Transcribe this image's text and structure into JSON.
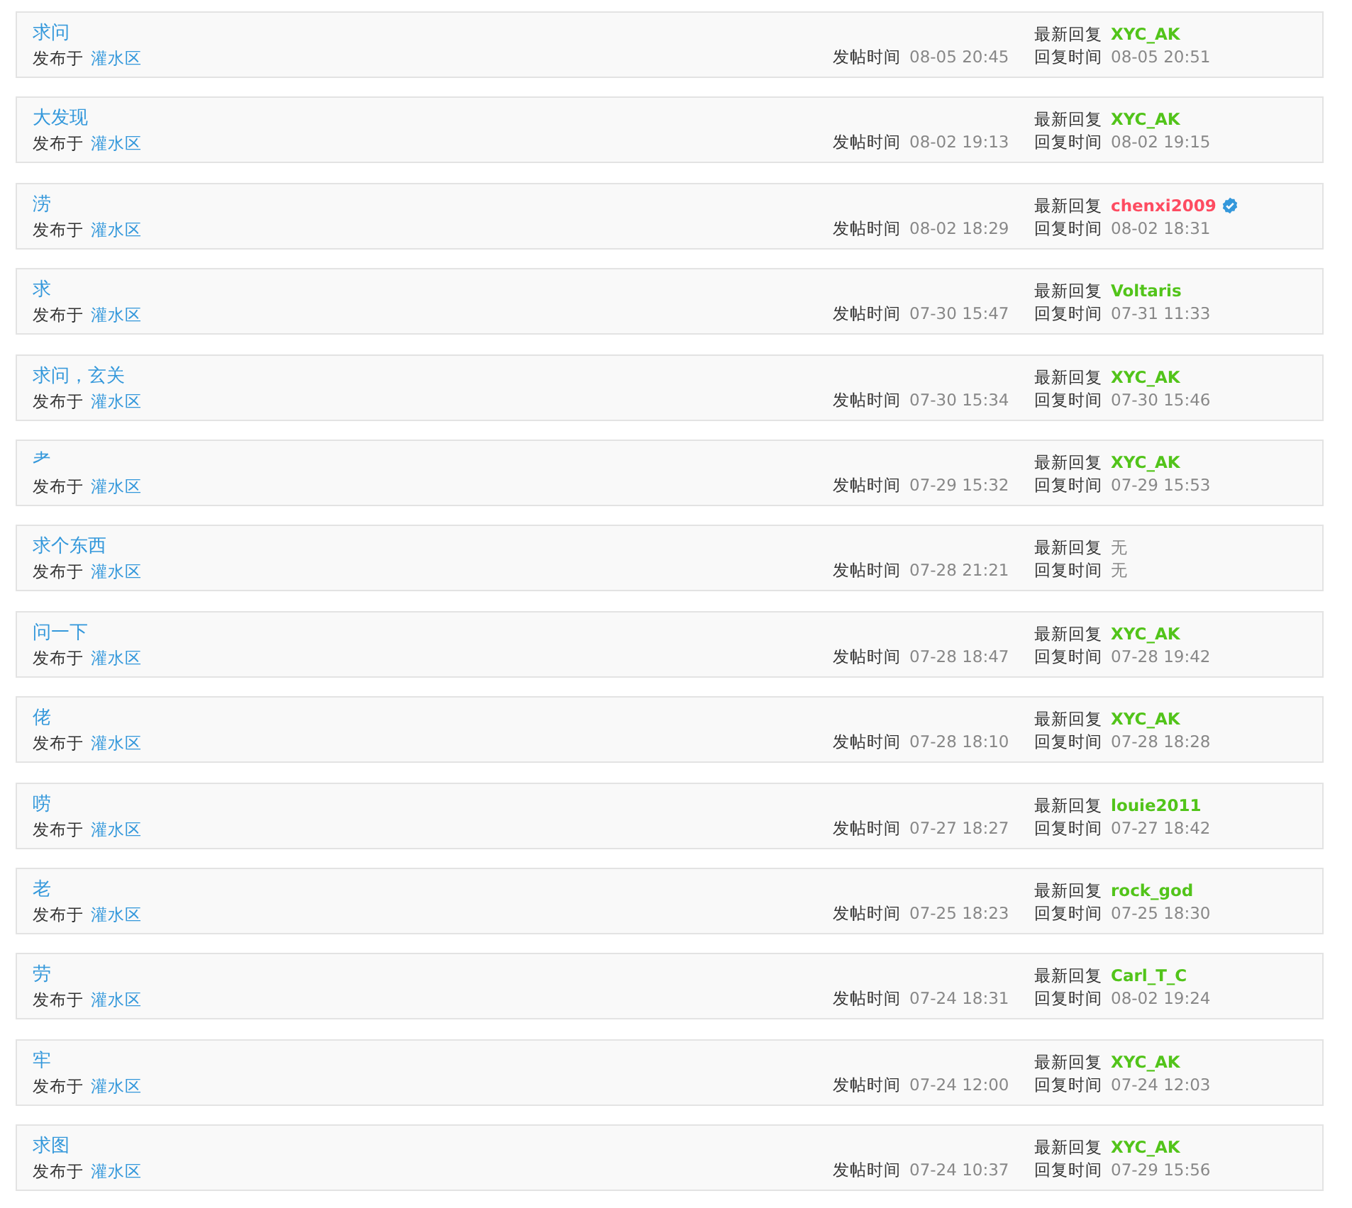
{
  "posts": [
    {
      "title": "求问",
      "posted_in_label": "发布于",
      "board": "灌水区",
      "post_time_label": "发帖时间",
      "post_time": "08-05 20:45",
      "reply_label": "最新回复",
      "reply_user": "XYC_AK",
      "color": "#52c41a",
      "verified": false,
      "reply_time_label": "回复时间",
      "reply_time": "08-05 20:51"
    },
    {
      "title": "大发现",
      "posted_in_label": "发布于",
      "board": "灌水区",
      "post_time_label": "发帖时间",
      "post_time": "08-02 19:13",
      "reply_label": "最新回复",
      "reply_user": "XYC_AK",
      "color": "#52c41a",
      "verified": false,
      "reply_time_label": "回复时间",
      "reply_time": "08-02 19:15"
    },
    {
      "title": "涝",
      "posted_in_label": "发布于",
      "board": "灌水区",
      "post_time_label": "发帖时间",
      "post_time": "08-02 18:29",
      "reply_label": "最新回复",
      "reply_user": "chenxi2009",
      "color": "#fe4c61",
      "verified": true,
      "reply_time_label": "回复时间",
      "reply_time": "08-02 18:31"
    },
    {
      "title": "求",
      "posted_in_label": "发布于",
      "board": "灌水区",
      "post_time_label": "发帖时间",
      "post_time": "07-30 15:47",
      "reply_label": "最新回复",
      "reply_user": "Voltaris",
      "color": "#52c41a",
      "verified": false,
      "reply_time_label": "回复时间",
      "reply_time": "07-31 11:33"
    },
    {
      "title": "求问，玄关",
      "posted_in_label": "发布于",
      "board": "灌水区",
      "post_time_label": "发帖时间",
      "post_time": "07-30 15:34",
      "reply_label": "最新回复",
      "reply_user": "XYC_AK",
      "color": "#52c41a",
      "verified": false,
      "reply_time_label": "回复时间",
      "reply_time": "07-30 15:46"
    },
    {
      "title": "耂",
      "posted_in_label": "发布于",
      "board": "灌水区",
      "post_time_label": "发帖时间",
      "post_time": "07-29 15:32",
      "reply_label": "最新回复",
      "reply_user": "XYC_AK",
      "color": "#52c41a",
      "verified": false,
      "reply_time_label": "回复时间",
      "reply_time": "07-29 15:53"
    },
    {
      "title": "求个东西",
      "posted_in_label": "发布于",
      "board": "灌水区",
      "post_time_label": "发帖时间",
      "post_time": "07-28 21:21",
      "reply_label": "最新回复",
      "reply_user": "无",
      "verified": false,
      "reply_time_label": "回复时间",
      "reply_time": "无"
    },
    {
      "title": "问一下",
      "posted_in_label": "发布于",
      "board": "灌水区",
      "post_time_label": "发帖时间",
      "post_time": "07-28 18:47",
      "reply_label": "最新回复",
      "reply_user": "XYC_AK",
      "color": "#52c41a",
      "verified": false,
      "reply_time_label": "回复时间",
      "reply_time": "07-28 19:42"
    },
    {
      "title": "佬",
      "posted_in_label": "发布于",
      "board": "灌水区",
      "post_time_label": "发帖时间",
      "post_time": "07-28 18:10",
      "reply_label": "最新回复",
      "reply_user": "XYC_AK",
      "color": "#52c41a",
      "verified": false,
      "reply_time_label": "回复时间",
      "reply_time": "07-28 18:28"
    },
    {
      "title": "唠",
      "posted_in_label": "发布于",
      "board": "灌水区",
      "post_time_label": "发帖时间",
      "post_time": "07-27 18:27",
      "reply_label": "最新回复",
      "reply_user": "louie2011",
      "color": "#52c41a",
      "verified": false,
      "reply_time_label": "回复时间",
      "reply_time": "07-27 18:42"
    },
    {
      "title": "老",
      "posted_in_label": "发布于",
      "board": "灌水区",
      "post_time_label": "发帖时间",
      "post_time": "07-25 18:23",
      "reply_label": "最新回复",
      "reply_user": "rock_god",
      "color": "#52c41a",
      "verified": false,
      "reply_time_label": "回复时间",
      "reply_time": "07-25 18:30"
    },
    {
      "title": "劳",
      "posted_in_label": "发布于",
      "board": "灌水区",
      "post_time_label": "发帖时间",
      "post_time": "07-24 18:31",
      "reply_label": "最新回复",
      "reply_user": "Carl_T_C",
      "color": "#52c41a",
      "verified": false,
      "reply_time_label": "回复时间",
      "reply_time": "08-02 19:24"
    },
    {
      "title": "牢",
      "posted_in_label": "发布于",
      "board": "灌水区",
      "post_time_label": "发帖时间",
      "post_time": "07-24 12:00",
      "reply_label": "最新回复",
      "reply_user": "XYC_AK",
      "color": "#52c41a",
      "verified": false,
      "reply_time_label": "回复时间",
      "reply_time": "07-24 12:03"
    },
    {
      "title": "求图",
      "posted_in_label": "发布于",
      "board": "灌水区",
      "post_time_label": "发帖时间",
      "post_time": "07-24 10:37",
      "reply_label": "最新回复",
      "reply_user": "XYC_AK",
      "color": "#52c41a",
      "verified": false,
      "reply_time_label": "回复时间",
      "reply_time": "07-29 15:56"
    }
  ]
}
